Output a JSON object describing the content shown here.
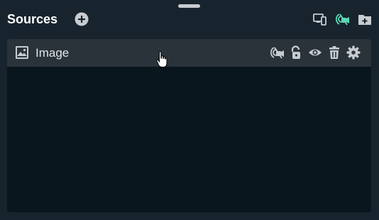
{
  "panel": {
    "title": "Sources"
  },
  "header_icons": [
    "add-circle-icon",
    "devices-icon",
    "selective-recording-icon",
    "add-folder-icon"
  ],
  "sources": [
    {
      "name": "Image",
      "type_icon": "image-icon",
      "action_icons": [
        "selective-recording-icon",
        "unlock-icon",
        "eye-icon",
        "trash-icon",
        "gear-icon"
      ]
    }
  ],
  "colors": {
    "background": "#17242d",
    "list_background": "#09161e",
    "selected_row": "#2a3339",
    "accent": "#5bd8b5",
    "icon": "#c7ccd1"
  }
}
